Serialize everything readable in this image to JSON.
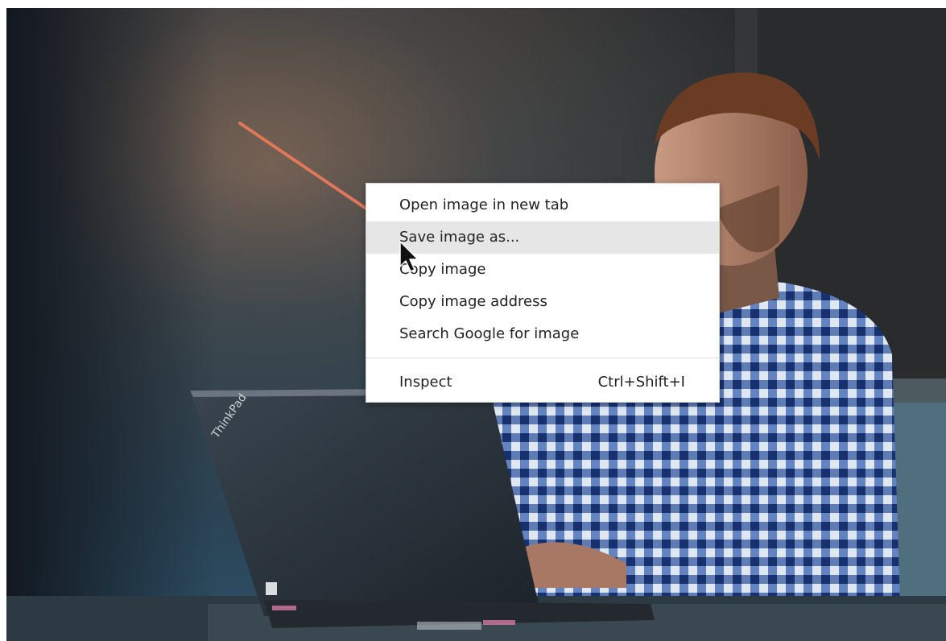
{
  "context_menu": {
    "items": [
      {
        "label": "Open image in new tab"
      },
      {
        "label": "Save image as..."
      },
      {
        "label": "Copy image"
      },
      {
        "label": "Copy image address"
      },
      {
        "label": "Search Google for image"
      }
    ],
    "inspect": {
      "label": "Inspect",
      "shortcut": "Ctrl+Shift+I"
    },
    "hovered_item": "Save image as..."
  },
  "annotation": {
    "arrow_color": "#e0775a"
  },
  "photo": {
    "laptop_logo": "ThinkPad",
    "description_icon": "man-with-laptop-photo"
  }
}
